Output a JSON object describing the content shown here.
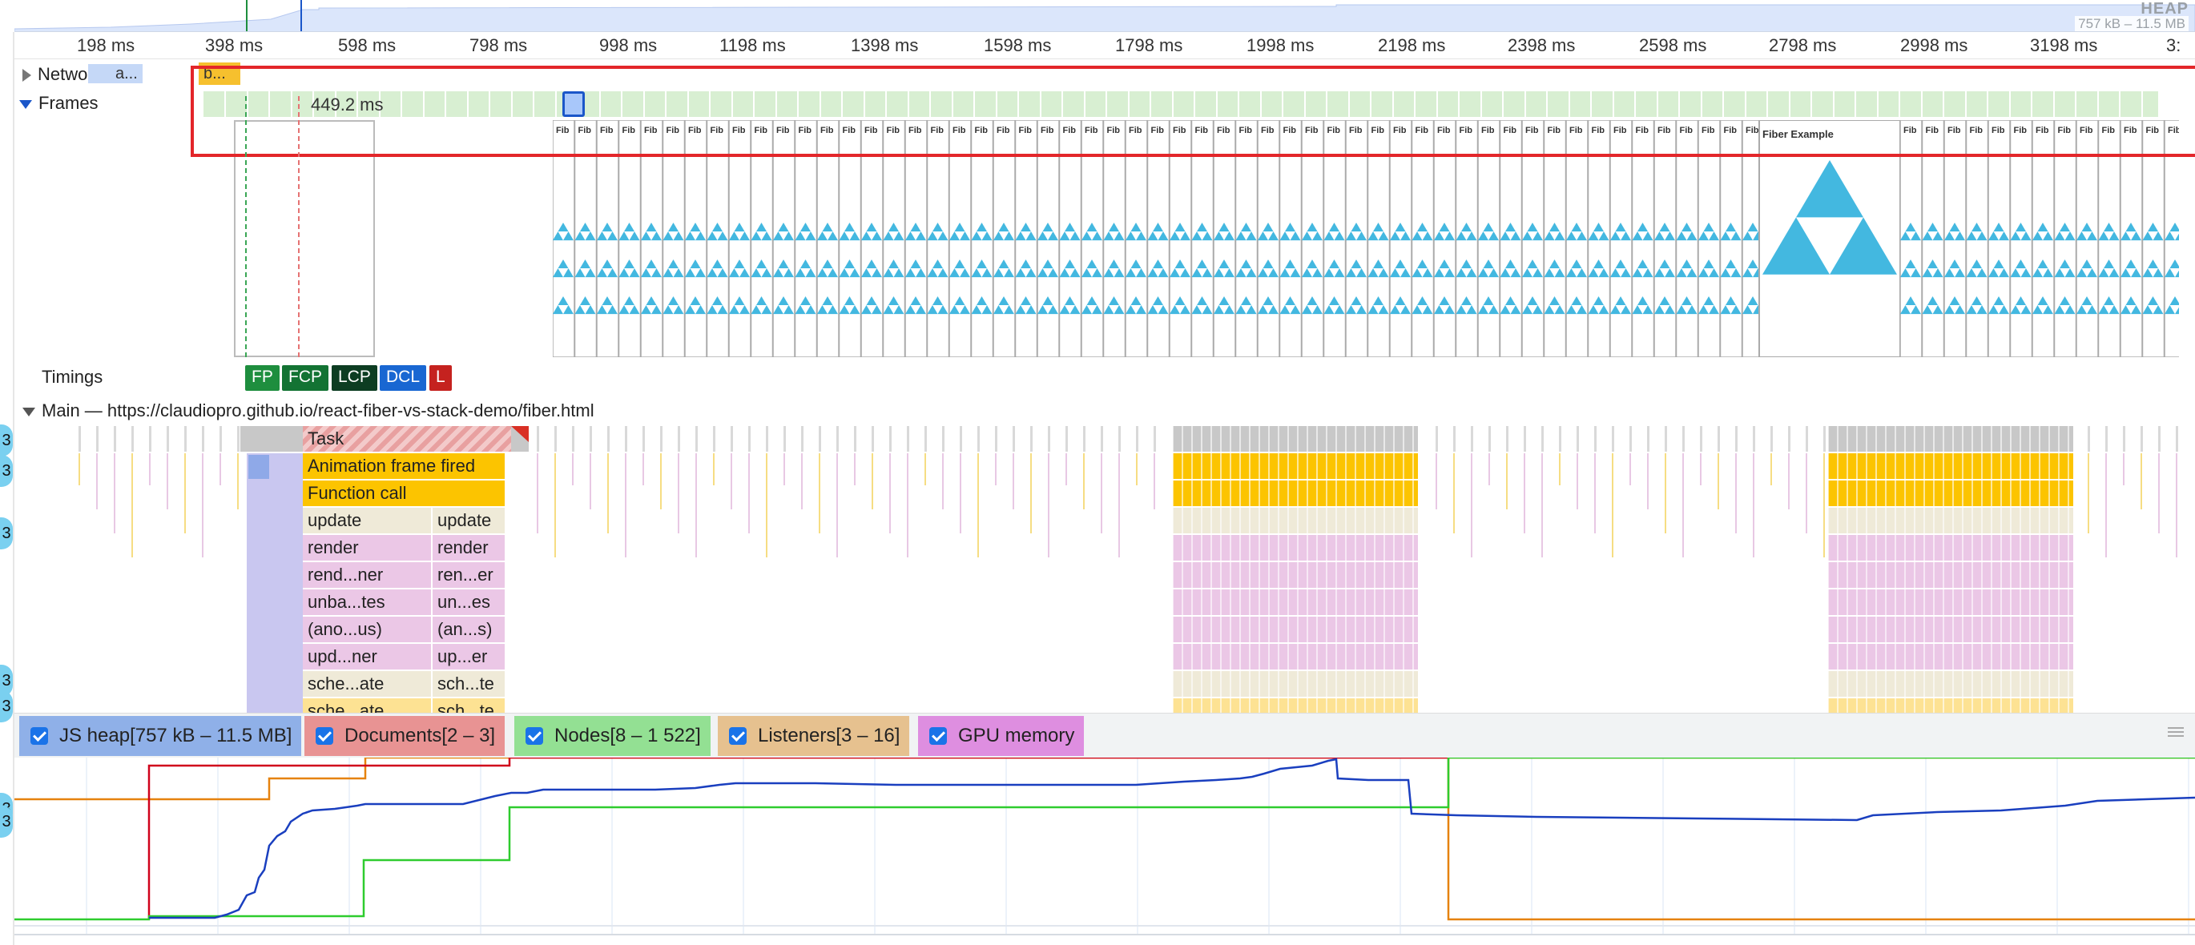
{
  "overview": {
    "heap_label": "HEAP",
    "heap_range": "757 kB – 11.5 MB"
  },
  "ruler": {
    "ticks": [
      "198 ms",
      "398 ms",
      "598 ms",
      "798 ms",
      "998 ms",
      "1198 ms",
      "1398 ms",
      "1598 ms",
      "1798 ms",
      "1998 ms",
      "2198 ms",
      "2398 ms",
      "2598 ms",
      "2798 ms",
      "2998 ms",
      "3198 ms",
      "3:"
    ]
  },
  "tracks": {
    "network_label": "Network",
    "network_item": "a...",
    "network_chip": "b...",
    "frames_label": "Frames",
    "frame_duration": "449.2 ms",
    "screenshot_label": "Fib",
    "screenshot_large_label": "Fiber Example",
    "timings_label": "Timings",
    "main_label": "Main — https://claudiopro.github.io/react-fiber-vs-stack-demo/fiber.html"
  },
  "timings": {
    "badges": [
      {
        "label": "FP",
        "color": "#1e8e3e"
      },
      {
        "label": "FCP",
        "color": "#137333"
      },
      {
        "label": "LCP",
        "color": "#0d3d22"
      },
      {
        "label": "DCL",
        "color": "#1967d2"
      },
      {
        "label": "L",
        "color": "#c5221f"
      }
    ]
  },
  "flame": {
    "task": "Task",
    "animation_frame": "Animation frame fired",
    "function_call": "Function call",
    "col1": [
      "update",
      "render",
      "rend...ner",
      "unba...tes",
      "(ano...us)",
      "upd...ner",
      "sche...ate",
      "sche...ate"
    ],
    "col2": [
      "update",
      "render",
      "ren...er",
      "un...es",
      "(an...s)",
      "up...er",
      "sch...te",
      "sch...te"
    ]
  },
  "memory_legend": [
    {
      "label": "JS heap[757 kB – 11.5 MB]",
      "color": "#8fb0e8"
    },
    {
      "label": "Documents[2 – 3]",
      "color": "#e89393"
    },
    {
      "label": "Nodes[8 – 1 522]",
      "color": "#93e093"
    },
    {
      "label": "Listeners[3 – 16]",
      "color": "#e6c18f"
    },
    {
      "label": "GPU memory",
      "color": "#de8ee0"
    }
  ],
  "edge_markers": [
    "3",
    "3",
    "3",
    "3",
    "3",
    "3",
    "3"
  ],
  "colors": {
    "js_heap_line": "#1a3fbf",
    "documents_line": "#d0021b",
    "nodes_line": "#2ecc2e",
    "listeners_line": "#e6820e",
    "task_gray": "#c8c8c8",
    "function_yellow": "#fcc400",
    "script_pink": "#ebc7e6",
    "screenshot_blue": "#43b8e0"
  }
}
